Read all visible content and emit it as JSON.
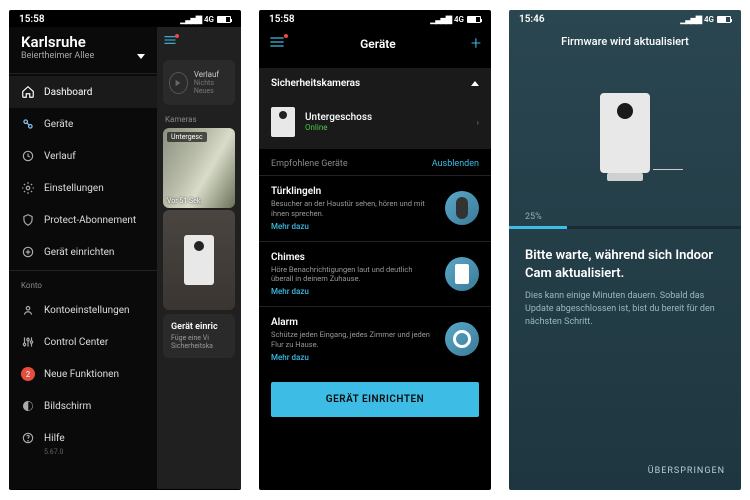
{
  "screen1": {
    "status_time": "15:58",
    "signal": "4G",
    "location_title": "Karlsruhe",
    "location_sub": "Beiertheimer Allee",
    "nav": {
      "dashboard": "Dashboard",
      "devices": "Geräte",
      "history": "Verlauf",
      "settings": "Einstellungen",
      "protect": "Protect-Abonnement",
      "setup": "Gerät einrichten"
    },
    "account_section": "Konto",
    "account": {
      "settings": "Kontoeinstellungen",
      "control": "Control Center",
      "new_features": "Neue Funktionen",
      "new_features_badge": "2",
      "screen": "Bildschirm",
      "help": "Hilfe",
      "version": "5.67.0"
    },
    "right": {
      "history_label": "Verlauf",
      "history_empty": "Nichts Neues",
      "cameras_label": "Kameras",
      "cam_name": "Untergesc",
      "cam_ts": "Vor 51 Sek.",
      "setup_title": "Gerät einric",
      "setup_desc": "Füge eine Vi\nSicherheitska"
    }
  },
  "screen2": {
    "status_time": "15:58",
    "signal": "4G",
    "header_title": "Geräte",
    "section_title": "Sicherheitskameras",
    "device": {
      "name": "Untergeschoss",
      "status": "Online"
    },
    "recommended_label": "Empfohlene Geräte",
    "hide_label": "Ausblenden",
    "recs": [
      {
        "title": "Türklingeln",
        "desc": "Besucher an der Haustür sehen, hören und mit ihnen sprechen.",
        "more": "Mehr dazu"
      },
      {
        "title": "Chimes",
        "desc": "Höre Benachrichtigungen laut und deutlich überall in deinem Zuhause.",
        "more": "Mehr dazu"
      },
      {
        "title": "Alarm",
        "desc": "Schütze jeden Eingang, jedes Zimmer und jeden Flur zu Hause.",
        "more": "Mehr dazu"
      }
    ],
    "cta": "GERÄT EINRICHTEN"
  },
  "screen3": {
    "status_time": "15:46",
    "signal": "4G",
    "title": "Firmware wird aktualisiert",
    "percent": "25%",
    "progress_pct": 25,
    "heading": "Bitte warte, während sich Indoor Cam aktualisiert.",
    "body": "Dies kann einige Minuten dauern. Sobald das Update abgeschlossen ist, bist du bereit für den nächsten Schritt.",
    "skip": "ÜBERSPRINGEN"
  }
}
